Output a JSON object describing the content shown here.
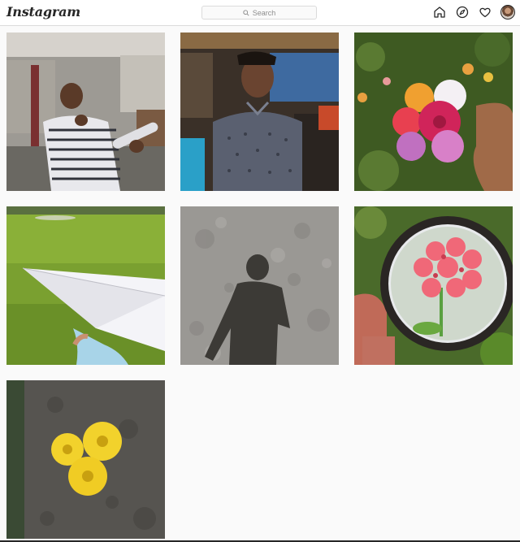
{
  "header": {
    "logo_text": "Instagram",
    "search": {
      "placeholder": "Search",
      "icon": "search-icon"
    },
    "nav": [
      {
        "name": "home",
        "icon": "home-icon"
      },
      {
        "name": "explore",
        "icon": "compass-icon"
      },
      {
        "name": "activity",
        "icon": "heart-icon"
      },
      {
        "name": "profile",
        "icon": "avatar"
      }
    ]
  },
  "posts": [
    {
      "subject": "man in striped shirt on rooftop"
    },
    {
      "subject": "young man in patterned shirt in cafe"
    },
    {
      "subject": "hand holding multicolor flower bouquet"
    },
    {
      "subject": "paper plane over grass field"
    },
    {
      "subject": "shadow of person on concrete"
    },
    {
      "subject": "pink flower through magnifying glass"
    },
    {
      "subject": "yellow flowers on dark stone"
    }
  ],
  "colors": {
    "background": "#fafafa",
    "header_bg": "#ffffff",
    "border": "#dbdbdb",
    "icon": "#262626",
    "muted": "#8e8e8e"
  }
}
